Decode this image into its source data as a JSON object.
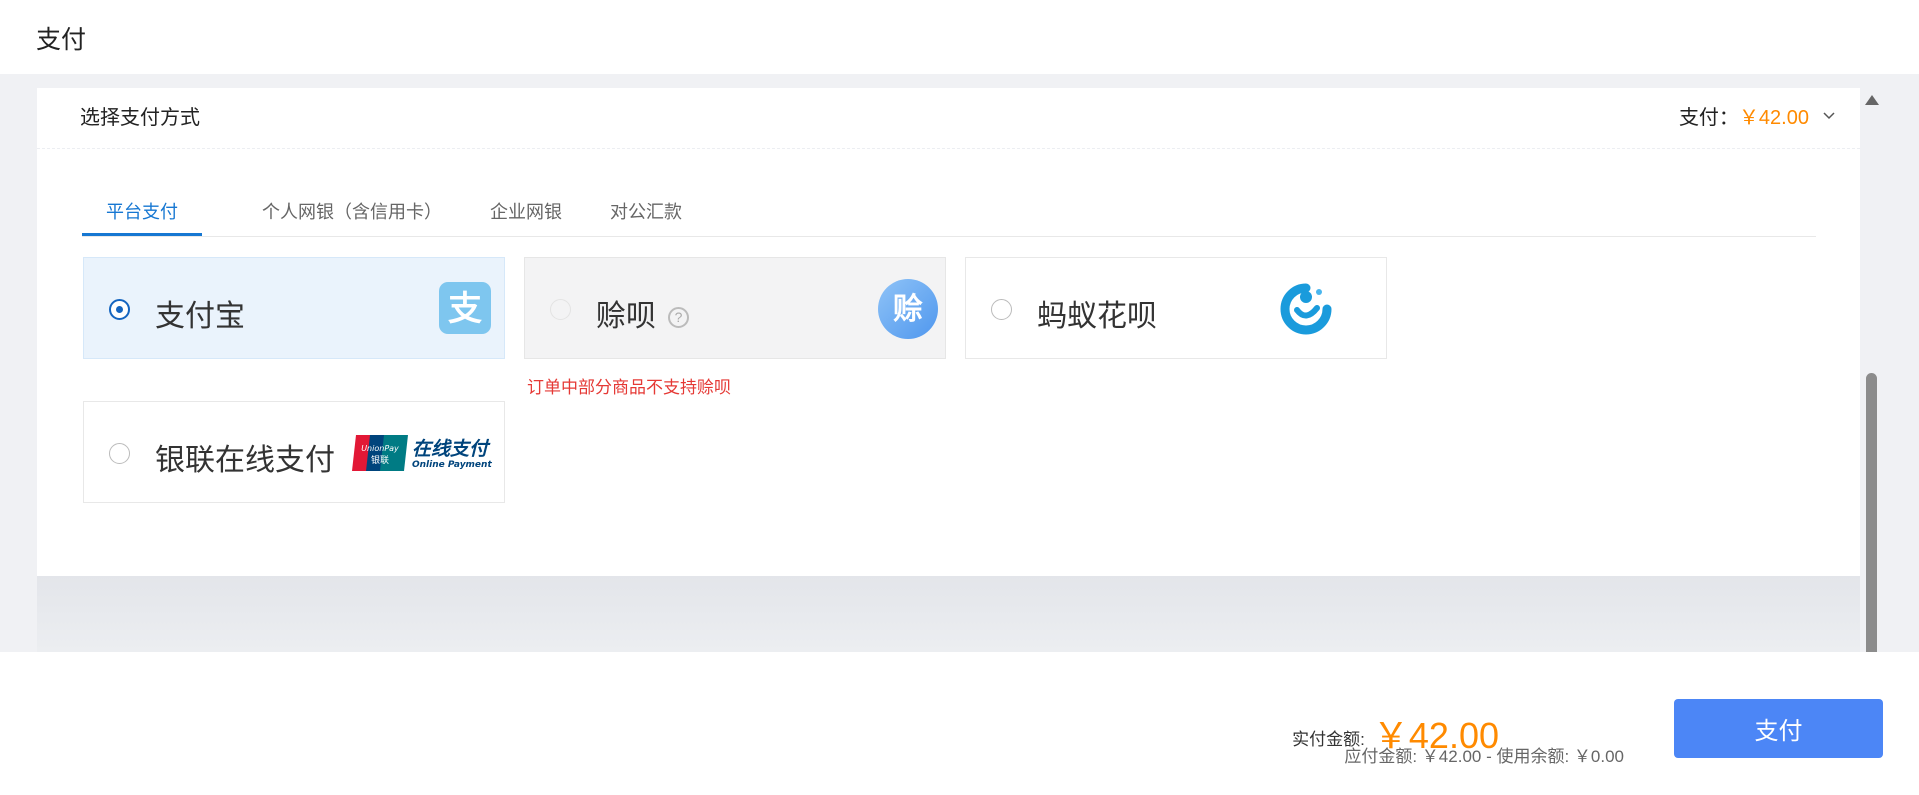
{
  "header": {
    "title": "支付"
  },
  "section": {
    "title": "选择支付方式",
    "pay_label": "支付：",
    "pay_amount": "￥42.00",
    "expand_icon": "chevron-down-icon"
  },
  "tabs": [
    {
      "label": "平台支付",
      "active": true
    },
    {
      "label": "个人网银（含信用卡）",
      "active": false
    },
    {
      "label": "企业网银",
      "active": false
    },
    {
      "label": "对公汇款",
      "active": false
    }
  ],
  "methods": [
    {
      "label": "支付宝",
      "selected": true,
      "disabled": false,
      "icon": "alipay-icon"
    },
    {
      "label": "赊呗",
      "selected": false,
      "disabled": true,
      "icon": "shebei-icon",
      "help_icon": "?",
      "warning": "订单中部分商品不支持赊呗"
    },
    {
      "label": "蚂蚁花呗",
      "selected": false,
      "disabled": false,
      "icon": "huabei-icon"
    },
    {
      "label": "银联在线支付",
      "selected": false,
      "disabled": false,
      "icon": "unionpay-logo",
      "logo_text": {
        "brand": "UnionPay",
        "brand_cn": "银联",
        "cn": "在线支付",
        "en": "Online Payment"
      }
    }
  ],
  "footer": {
    "actual_label": "实付金额:",
    "actual_amount": "￥42.00",
    "detail": "应付金额: ￥42.00 - 使用余额: ￥0.00",
    "pay_button": "支付"
  },
  "colors": {
    "accent": "#1677d2",
    "price": "#ff8a00",
    "button": "#4c86f6",
    "warning": "#e53935"
  }
}
